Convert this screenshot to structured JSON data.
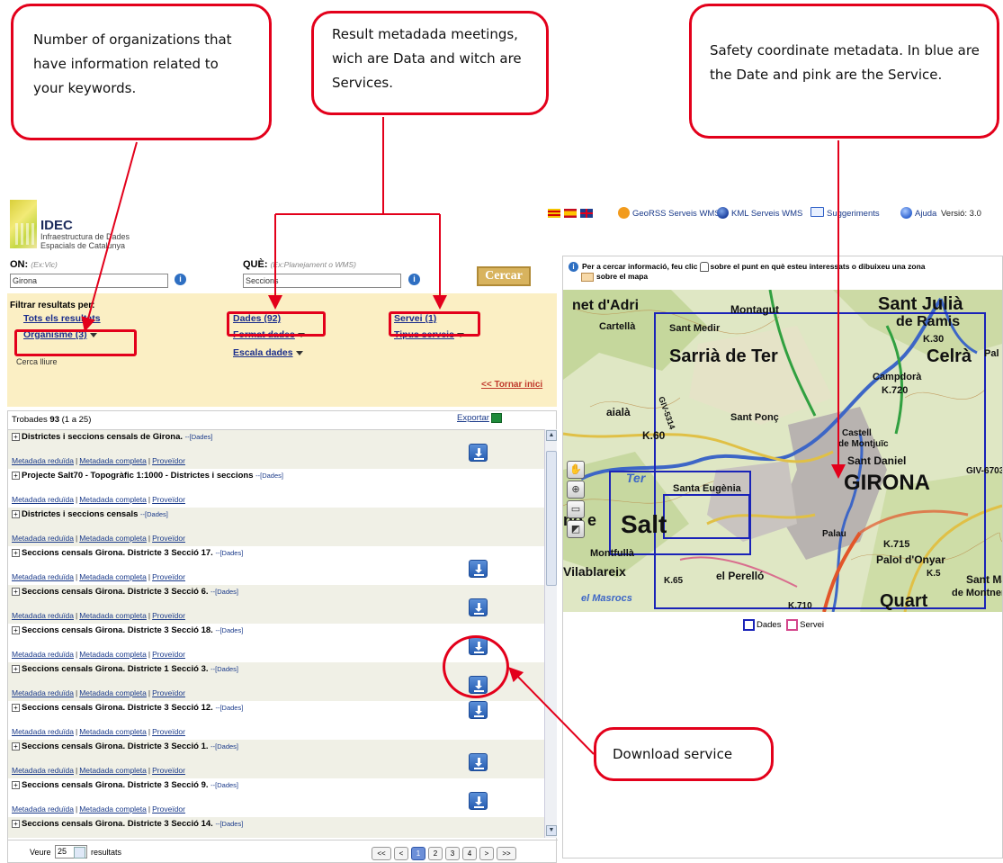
{
  "callouts": {
    "organizations": "Number of organizations that have information related to your keywords.",
    "results": "Result metadada meetings, wich are Data and witch are Services.",
    "safety": "Safety coordinate metadata. In blue are the Date and pink are the Service.",
    "download": "Download service"
  },
  "logo": {
    "title": "IDEC",
    "subtitle_line1": "Infraestructura de Dades",
    "subtitle_line2": "Espacials de Catalunya"
  },
  "topbar": {
    "georss": "GeoRSS Serveis WMS",
    "kml": "KML Serveis WMS",
    "suggeriments": "Suggeriments",
    "ajuda": "Ajuda",
    "version": "Versió: 3.0"
  },
  "search": {
    "on_label": "ON:",
    "on_hint": "(Ex:Vic)",
    "on_value": "Girona",
    "que_label": "QUÈ:",
    "que_hint": "(Ex:Planejament o WMS)",
    "que_value": "Seccions",
    "button": "Cercar"
  },
  "filters": {
    "title": "Filtrar resultats per:",
    "tots": "Tots els resultats",
    "organisme": "Organisme (3)",
    "cerca_lliure": "Cerca lliure",
    "dades": "Dades (92)",
    "format_dades": "Format dades",
    "escala_dades": "Escala dades",
    "servei": "Servei (1)",
    "tipus_serveis": "Tipus serveis",
    "tornar": "<< Tornar inici"
  },
  "results": {
    "found_label": "Trobades",
    "found_count": "93",
    "found_range": "(1 a 25)",
    "export": "Exportar",
    "link_reduida": "Metadada reduïda",
    "link_completa": "Metadada completa",
    "link_proveidor": "Proveïdor",
    "items": [
      {
        "title": "Districtes i seccions censals de Girona.",
        "tag": "--[Dades]"
      },
      {
        "title": "Projecte Salt70 - Topogràfic 1:1000 - Districtes i seccions",
        "tag": "--[Dades]"
      },
      {
        "title": "Districtes i seccions censals",
        "tag": "--[Dades]"
      },
      {
        "title": "Seccions censals Girona. Districte 3 Secció 17.",
        "tag": "--[Dades]"
      },
      {
        "title": "Seccions censals Girona. Districte 3 Secció 6.",
        "tag": "--[Dades]"
      },
      {
        "title": "Seccions censals Girona. Districte 3 Secció 18.",
        "tag": "--[Dades]"
      },
      {
        "title": "Seccions censals Girona. Districte 1 Secció 3.",
        "tag": "--[Dades]"
      },
      {
        "title": "Seccions censals Girona. Districte 3 Secció 12.",
        "tag": "--[Dades]"
      },
      {
        "title": "Seccions censals Girona. Districte 3 Secció 1.",
        "tag": "--[Dades]"
      },
      {
        "title": "Seccions censals Girona. Districte 3 Secció 9.",
        "tag": "--[Dades]"
      },
      {
        "title": "Seccions censals Girona. Districte 3 Secció 14.",
        "tag": "--[Dades]"
      }
    ],
    "veure": "Veure",
    "per_page": "25",
    "resultats": "resultats",
    "pager": [
      "<<",
      "<",
      "1",
      "2",
      "3",
      "4",
      ">",
      ">>"
    ]
  },
  "map": {
    "info_part1": "Per a cercar informació, feu clic",
    "info_part2": "sobre el punt en què esteu interessats o dibuixeu una zona",
    "info_part3": "sobre el mapa",
    "labels": {
      "adri": "net d'Adri",
      "cartella": "Cartellà",
      "sant_medir": "Sant Medir",
      "montagut": "Montagut",
      "sant_julia": "Sant Julià",
      "de_ramis": "de Ramis",
      "k30": "K.30",
      "celra": "Celrà",
      "pal": "Pal",
      "sarria": "Sarrià de Ter",
      "campdora": "Campdorà",
      "k720": "K.720",
      "sant_ponc": "Sant Ponç",
      "aiala": "aialà",
      "k60": "K.60",
      "castell": "Castell",
      "montjuic": "de Montjuïc",
      "sant_daniel": "Sant Daniel",
      "girona": "GIRONA",
      "gi670": "GIV-6703",
      "santa_eugenia": "Santa Eugènia",
      "salt": "Salt",
      "no_e": "no e",
      "ter": "Ter",
      "montfulla": "Montfullà",
      "palau": "Palau",
      "k715": "K.715",
      "palol": "Palol d'Onyar",
      "k5": "K.5",
      "vilablareix": "Vilablareix",
      "k65": "K.65",
      "el_perello": "el Perelló",
      "masrocs": "el Masrocs",
      "sant_martin": "Sant Ma",
      "montner": "de Montner",
      "quart": "Quart",
      "k710": "K.710",
      "gi531": "GIV-5314"
    },
    "legend_dades": "Dades",
    "legend_servei": "Servei"
  },
  "colors": {
    "callout_red": "#e3001b",
    "dades_blue": "#1a23b8",
    "servei_pink": "#d4478c",
    "filter_bg": "#fbefc4",
    "link_blue": "#1a2d8c"
  }
}
